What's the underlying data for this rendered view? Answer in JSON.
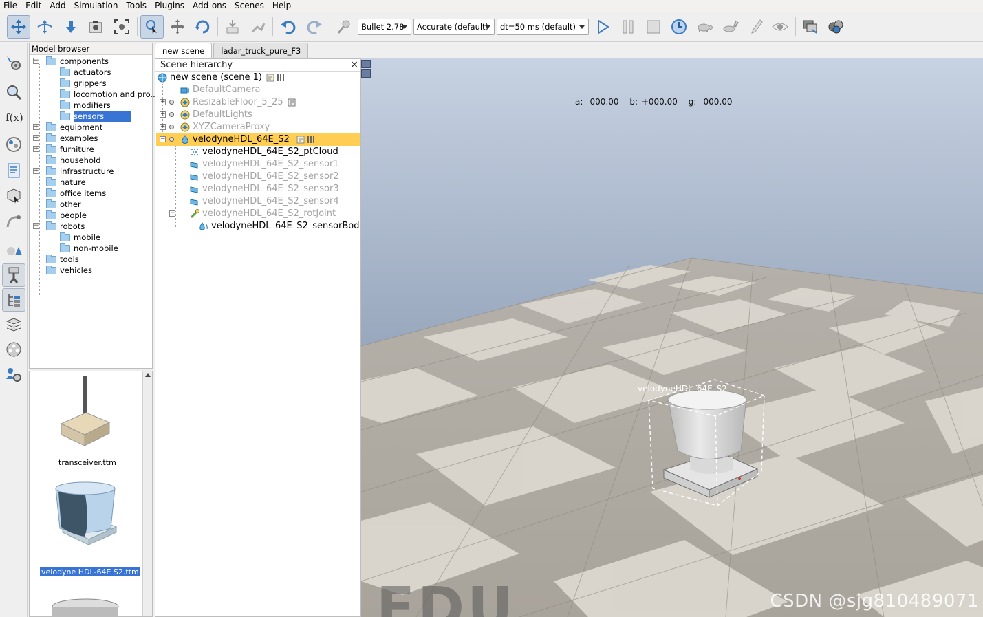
{
  "menu": [
    "File",
    "Edit",
    "Add",
    "Simulation",
    "Tools",
    "Plugins",
    "Add-ons",
    "Scenes",
    "Help"
  ],
  "toolbar": {
    "engine": "Bullet 2.78",
    "accuracy": "Accurate (default)",
    "timestep": "dt=50 ms (default)"
  },
  "model_browser": {
    "title": "Model browser",
    "items": [
      {
        "label": "components",
        "expander": "−"
      },
      {
        "label": "actuators"
      },
      {
        "label": "grippers"
      },
      {
        "label": "locomotion and pro..."
      },
      {
        "label": "modifiers"
      },
      {
        "label": "sensors"
      },
      {
        "label": "equipment",
        "expander": "+"
      },
      {
        "label": "examples",
        "expander": "+"
      },
      {
        "label": "furniture",
        "expander": "+"
      },
      {
        "label": "household"
      },
      {
        "label": "infrastructure",
        "expander": "+"
      },
      {
        "label": "nature"
      },
      {
        "label": "office items"
      },
      {
        "label": "other"
      },
      {
        "label": "people"
      },
      {
        "label": "robots",
        "expander": "−"
      },
      {
        "label": "mobile"
      },
      {
        "label": "non-mobile"
      },
      {
        "label": "tools"
      },
      {
        "label": "vehicles"
      }
    ]
  },
  "thumbnails": [
    {
      "caption": "transceiver.ttm"
    },
    {
      "caption": "velodyne HDL-64E S2.ttm"
    }
  ],
  "tabs": [
    "new scene",
    "ladar_truck_pure_F3"
  ],
  "scene_hierarchy": {
    "title": "Scene hierarchy",
    "close": "×",
    "rows": [
      {
        "label": "new scene (scene 1)"
      },
      {
        "label": "DefaultCamera"
      },
      {
        "label": "ResizableFloor_5_25"
      },
      {
        "label": "DefaultLights"
      },
      {
        "label": "XYZCameraProxy"
      },
      {
        "label": "velodyneHDL_64E_S2"
      },
      {
        "label": "velodyneHDL_64E_S2_ptCloud"
      },
      {
        "label": "velodyneHDL_64E_S2_sensor1"
      },
      {
        "label": "velodyneHDL_64E_S2_sensor2"
      },
      {
        "label": "velodyneHDL_64E_S2_sensor3"
      },
      {
        "label": "velodyneHDL_64E_S2_sensor4"
      },
      {
        "label": "velodyneHDL_64E_S2_rotJoint"
      },
      {
        "label": "velodyneHDL_64E_S2_sensorBod"
      }
    ]
  },
  "viewport": {
    "angles": {
      "a": "a: -000.00",
      "b": "b: +000.00",
      "g": "g: -000.00"
    },
    "object_label": "velodyneHDL_64E_S2",
    "watermark": "CSDN @sjg810489071",
    "watermark_edu": "EDU"
  }
}
